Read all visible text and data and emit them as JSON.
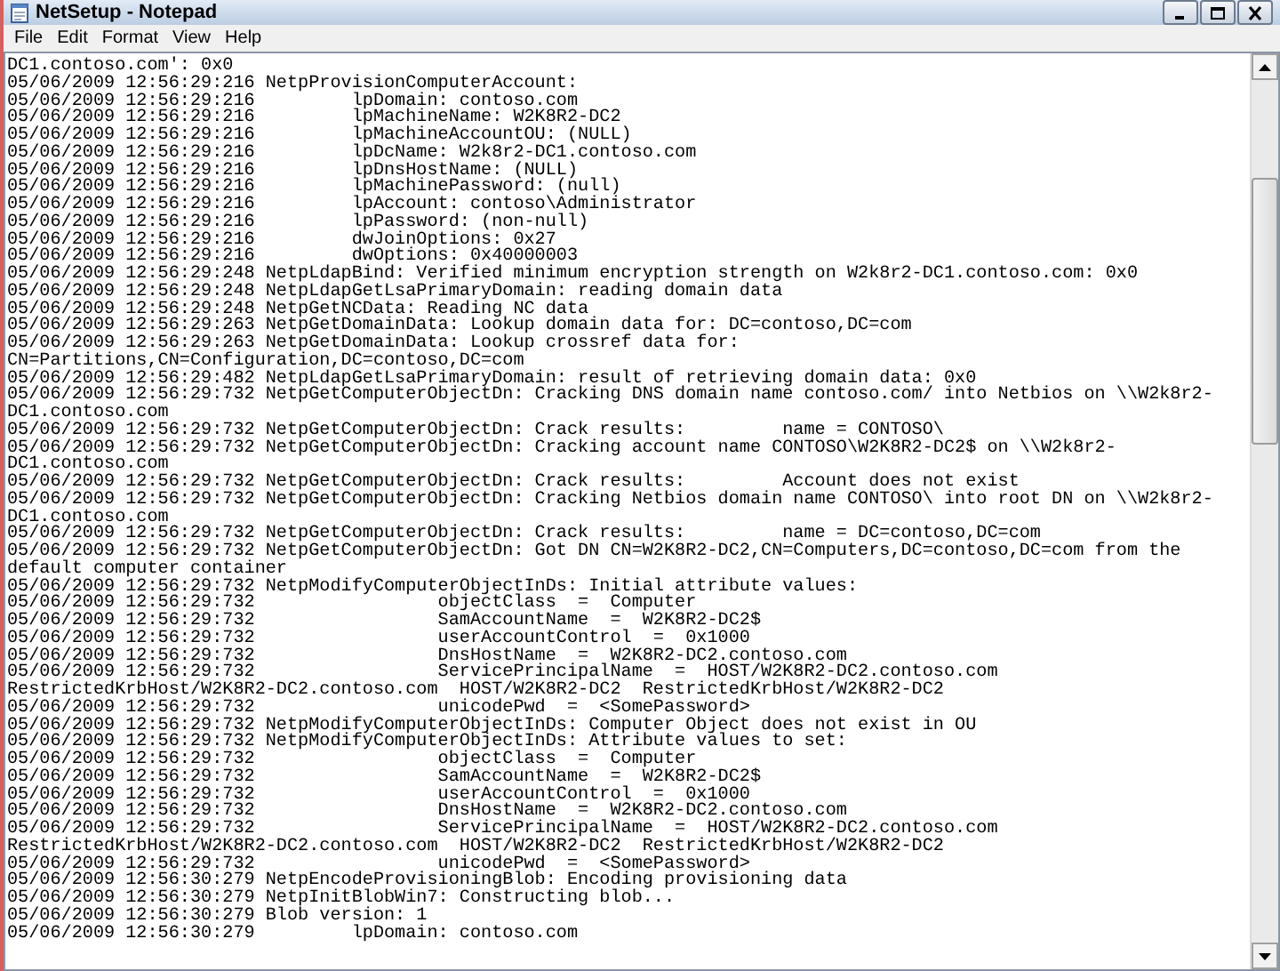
{
  "window": {
    "title": "NetSetup - Notepad"
  },
  "menu": [
    "File",
    "Edit",
    "Format",
    "View",
    "Help"
  ],
  "document": {
    "lines": [
      "DC1.contoso.com': 0x0",
      "05/06/2009 12:56:29:216 NetpProvisionComputerAccount:",
      "05/06/2009 12:56:29:216         lpDomain: contoso.com",
      "05/06/2009 12:56:29:216         lpMachineName: W2K8R2-DC2",
      "05/06/2009 12:56:29:216         lpMachineAccountOU: (NULL)",
      "05/06/2009 12:56:29:216         lpDcName: W2k8r2-DC1.contoso.com",
      "05/06/2009 12:56:29:216         lpDnsHostName: (NULL)",
      "05/06/2009 12:56:29:216         lpMachinePassword: (null)",
      "05/06/2009 12:56:29:216         lpAccount: contoso\\Administrator",
      "05/06/2009 12:56:29:216         lpPassword: (non-null)",
      "05/06/2009 12:56:29:216         dwJoinOptions: 0x27",
      "05/06/2009 12:56:29:216         dwOptions: 0x40000003",
      "05/06/2009 12:56:29:248 NetpLdapBind: Verified minimum encryption strength on W2k8r2-DC1.contoso.com: 0x0",
      "05/06/2009 12:56:29:248 NetpLdapGetLsaPrimaryDomain: reading domain data",
      "05/06/2009 12:56:29:248 NetpGetNCData: Reading NC data",
      "05/06/2009 12:56:29:263 NetpGetDomainData: Lookup domain data for: DC=contoso,DC=com",
      "05/06/2009 12:56:29:263 NetpGetDomainData: Lookup crossref data for:",
      "CN=Partitions,CN=Configuration,DC=contoso,DC=com",
      "05/06/2009 12:56:29:482 NetpLdapGetLsaPrimaryDomain: result of retrieving domain data: 0x0",
      "05/06/2009 12:56:29:732 NetpGetComputerObjectDn: Cracking DNS domain name contoso.com/ into Netbios on \\\\W2k8r2-",
      "DC1.contoso.com",
      "05/06/2009 12:56:29:732 NetpGetComputerObjectDn: Crack results:         name = CONTOSO\\",
      "05/06/2009 12:56:29:732 NetpGetComputerObjectDn: Cracking account name CONTOSO\\W2K8R2-DC2$ on \\\\W2k8r2-",
      "DC1.contoso.com",
      "05/06/2009 12:56:29:732 NetpGetComputerObjectDn: Crack results:         Account does not exist",
      "05/06/2009 12:56:29:732 NetpGetComputerObjectDn: Cracking Netbios domain name CONTOSO\\ into root DN on \\\\W2k8r2-",
      "DC1.contoso.com",
      "05/06/2009 12:56:29:732 NetpGetComputerObjectDn: Crack results:         name = DC=contoso,DC=com",
      "05/06/2009 12:56:29:732 NetpGetComputerObjectDn: Got DN CN=W2K8R2-DC2,CN=Computers,DC=contoso,DC=com from the",
      "default computer container",
      "05/06/2009 12:56:29:732 NetpModifyComputerObjectInDs: Initial attribute values:",
      "05/06/2009 12:56:29:732                 objectClass  =  Computer",
      "05/06/2009 12:56:29:732                 SamAccountName  =  W2K8R2-DC2$",
      "05/06/2009 12:56:29:732                 userAccountControl  =  0x1000",
      "05/06/2009 12:56:29:732                 DnsHostName  =  W2K8R2-DC2.contoso.com",
      "05/06/2009 12:56:29:732                 ServicePrincipalName  =  HOST/W2K8R2-DC2.contoso.com",
      "RestrictedKrbHost/W2K8R2-DC2.contoso.com  HOST/W2K8R2-DC2  RestrictedKrbHost/W2K8R2-DC2",
      "05/06/2009 12:56:29:732                 unicodePwd  =  <SomePassword>",
      "05/06/2009 12:56:29:732 NetpModifyComputerObjectInDs: Computer Object does not exist in OU",
      "05/06/2009 12:56:29:732 NetpModifyComputerObjectInDs: Attribute values to set:",
      "05/06/2009 12:56:29:732                 objectClass  =  Computer",
      "05/06/2009 12:56:29:732                 SamAccountName  =  W2K8R2-DC2$",
      "05/06/2009 12:56:29:732                 userAccountControl  =  0x1000",
      "05/06/2009 12:56:29:732                 DnsHostName  =  W2K8R2-DC2.contoso.com",
      "05/06/2009 12:56:29:732                 ServicePrincipalName  =  HOST/W2K8R2-DC2.contoso.com",
      "RestrictedKrbHost/W2K8R2-DC2.contoso.com  HOST/W2K8R2-DC2  RestrictedKrbHost/W2K8R2-DC2",
      "05/06/2009 12:56:29:732                 unicodePwd  =  <SomePassword>",
      "05/06/2009 12:56:30:279 NetpEncodeProvisioningBlob: Encoding provisioning data",
      "05/06/2009 12:56:30:279 NetpInitBlobWin7: Constructing blob...",
      "05/06/2009 12:56:30:279 Blob version: 1",
      "05/06/2009 12:56:30:279         lpDomain: contoso.com"
    ]
  }
}
